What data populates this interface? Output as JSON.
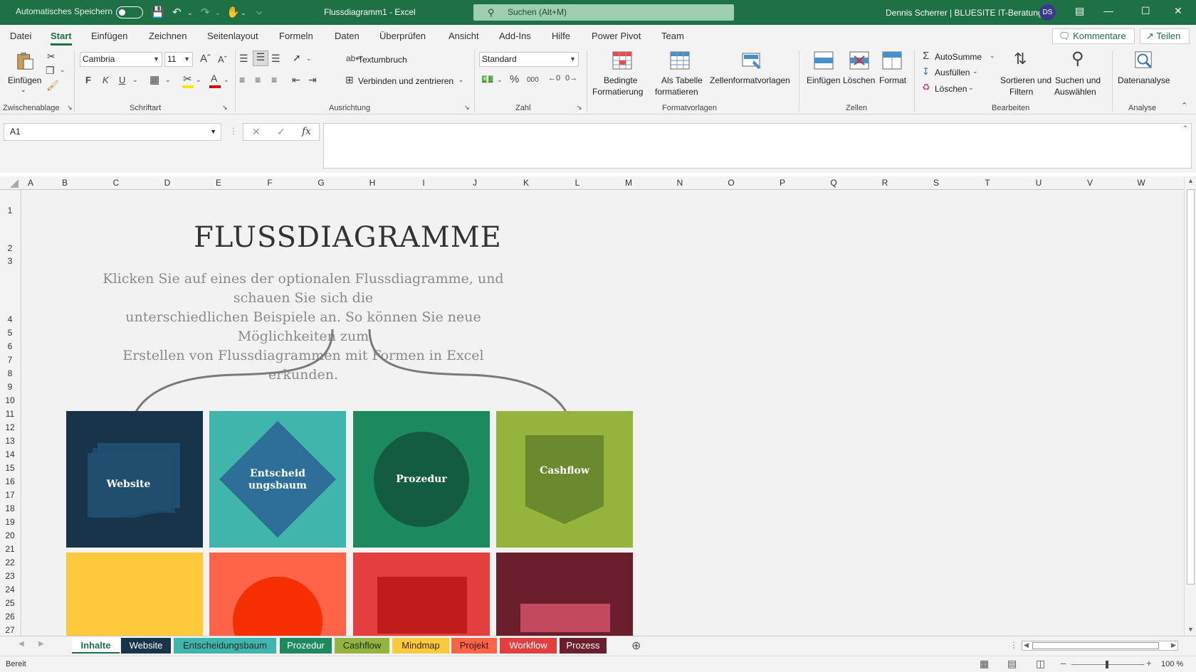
{
  "titlebar": {
    "autosave_label": "Automatisches Speichern",
    "doc_title": "Flussdiagramm1  -  Excel",
    "search_placeholder": "Suchen (Alt+M)",
    "user": "Dennis Scherrer | BLUESITE IT-Beratung",
    "avatar_initials": "DS"
  },
  "menu": {
    "tabs": [
      "Datei",
      "Start",
      "Einfügen",
      "Zeichnen",
      "Seitenlayout",
      "Formeln",
      "Daten",
      "Überprüfen",
      "Ansicht",
      "Add-Ins",
      "Hilfe",
      "Power Pivot",
      "Team"
    ],
    "active": "Start",
    "kommentare": "Kommentare",
    "teilen": "Teilen"
  },
  "ribbon": {
    "clipboard": {
      "paste": "Einfügen",
      "group": "Zwischenablage"
    },
    "font": {
      "name": "Cambria",
      "size": "11",
      "bold": "F",
      "italic": "K",
      "underline": "U",
      "group": "Schriftart"
    },
    "alignment": {
      "wrap": "Textumbruch",
      "merge": "Verbinden und zentrieren",
      "group": "Ausrichtung"
    },
    "number": {
      "format": "Standard",
      "percent": "%",
      "thousands": "000",
      "group": "Zahl"
    },
    "styles": {
      "conditional_1": "Bedingte",
      "conditional_2": "Formatierung",
      "table_1": "Als Tabelle",
      "table_2": "formatieren",
      "cellstyles": "Zellenformatvorlagen",
      "group": "Formatvorlagen"
    },
    "cells": {
      "insert": "Einfügen",
      "delete": "Löschen",
      "format": "Format",
      "group": "Zellen"
    },
    "editing": {
      "autosum": "AutoSumme",
      "fill": "Ausfüllen",
      "clear": "Löschen",
      "sort_1": "Sortieren und",
      "sort_2": "Filtern",
      "find_1": "Suchen und",
      "find_2": "Auswählen",
      "group": "Bearbeiten"
    },
    "analysis": {
      "data": "Datenanalyse",
      "group": "Analyse"
    }
  },
  "formula": {
    "namebox": "A1",
    "fx": "fx"
  },
  "columns": [
    "A",
    "B",
    "C",
    "D",
    "E",
    "F",
    "G",
    "H",
    "I",
    "J",
    "K",
    "L",
    "M",
    "N",
    "O",
    "P",
    "Q",
    "R",
    "S",
    "T",
    "U",
    "V",
    "W"
  ],
  "rows": [
    "1",
    "2",
    "3",
    "4",
    "5",
    "6",
    "7",
    "8",
    "9",
    "10",
    "11",
    "12",
    "13",
    "14",
    "15",
    "16",
    "17",
    "18",
    "19",
    "20",
    "21",
    "22",
    "23",
    "24",
    "25",
    "26",
    "27"
  ],
  "content": {
    "title": "FLUSSDIAGRAMME",
    "subtitle_lines": [
      "Klicken Sie auf eines der optionalen Flussdiagramme, und schauen Sie sich die",
      "unterschiedlichen Beispiele an. So können Sie neue Möglichkeiten zum",
      "Erstellen von Flussdiagrammen mit Formen in Excel erkunden."
    ],
    "tiles": [
      {
        "label": "Website",
        "bg": "#17344a",
        "shape": "#1f4e6e"
      },
      {
        "label_1": "Entscheid",
        "label_2": "ungsbaum",
        "bg": "#3fb5ab",
        "shape": "#2e6f99"
      },
      {
        "label": "Prozedur",
        "bg": "#1c8a5e",
        "shape": "#135c41"
      },
      {
        "label": "Cashflow",
        "bg": "#95b43e",
        "shape": "#6a8a2d"
      }
    ],
    "tiles_row2": [
      "#ffc93c",
      "#ff6449",
      "#e53e3e",
      "#6b1e2b"
    ]
  },
  "sheet_tabs": [
    {
      "label": "Inhalte",
      "color": "#ffffff",
      "active": true
    },
    {
      "label": "Website",
      "color": "#17344a"
    },
    {
      "label": "Entscheidungsbaum",
      "color": "#3fb5ab"
    },
    {
      "label": "Prozedur",
      "color": "#1c8a5e"
    },
    {
      "label": "Cashflow",
      "color": "#95b43e"
    },
    {
      "label": "Mindmap",
      "color": "#ffc93c"
    },
    {
      "label": "Projekt",
      "color": "#ff6449"
    },
    {
      "label": "Workflow",
      "color": "#e53e3e"
    },
    {
      "label": "Prozess",
      "color": "#6b1e2b"
    }
  ],
  "status": {
    "ready": "Bereit",
    "zoom": "100 %"
  }
}
